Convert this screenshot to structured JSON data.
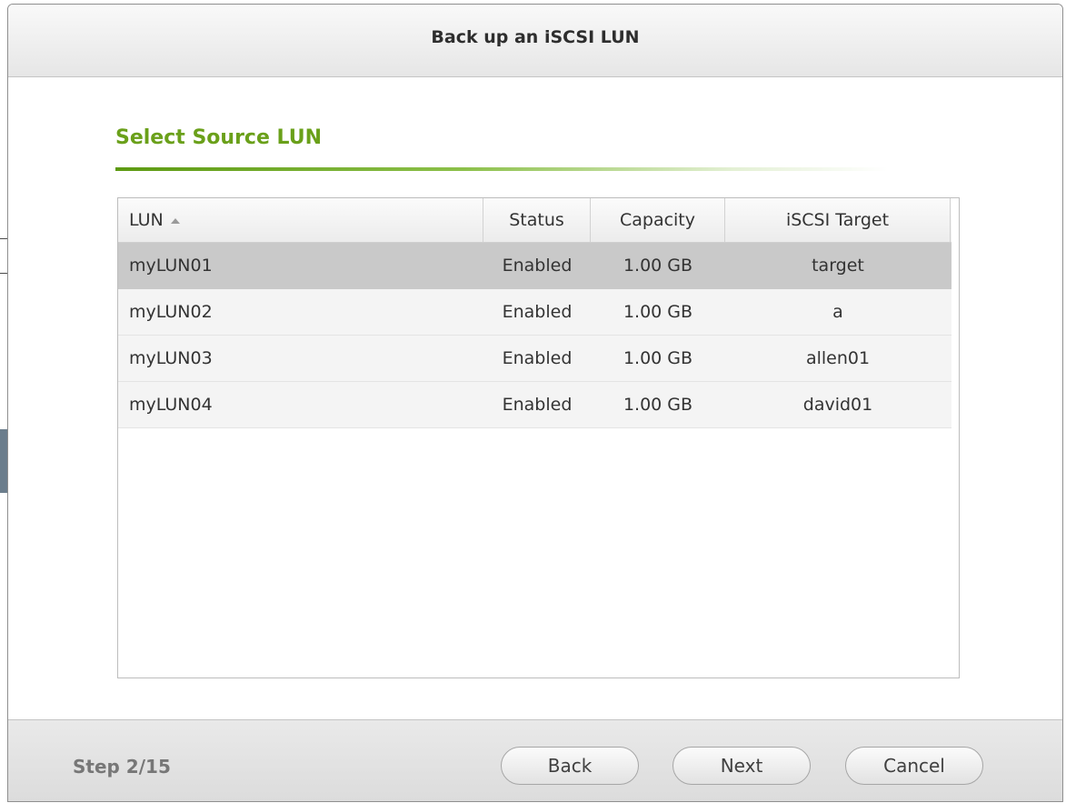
{
  "dialog": {
    "title": "Back up an iSCSI LUN"
  },
  "section": {
    "title": "Select Source LUN"
  },
  "table": {
    "columns": [
      "LUN",
      "Status",
      "Capacity",
      "iSCSI Target"
    ],
    "sort_column": "LUN",
    "sort_direction": "ascending",
    "selected_row": 0,
    "rows": [
      {
        "lun": "myLUN01",
        "status": "Enabled",
        "capacity": "1.00 GB",
        "target": "target"
      },
      {
        "lun": "myLUN02",
        "status": "Enabled",
        "capacity": "1.00 GB",
        "target": "a"
      },
      {
        "lun": "myLUN03",
        "status": "Enabled",
        "capacity": "1.00 GB",
        "target": "allen01"
      },
      {
        "lun": "myLUN04",
        "status": "Enabled",
        "capacity": "1.00 GB",
        "target": "david01"
      }
    ]
  },
  "footer": {
    "step": "Step 2/15",
    "back_label": "Back",
    "next_label": "Next",
    "cancel_label": "Cancel"
  },
  "colors": {
    "accent": "#6aa01a",
    "selected_row": "#c9c9c9"
  },
  "icons": {
    "sort": "sort-ascending-icon"
  }
}
